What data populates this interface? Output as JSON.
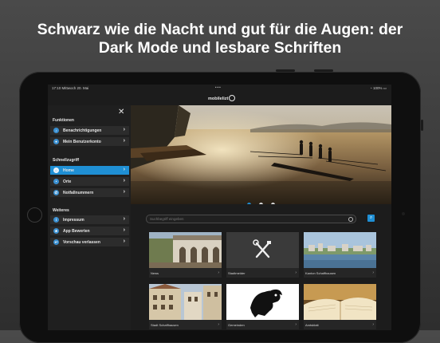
{
  "headline": {
    "line1": "Schwarz wie die Nacht und gut für die Augen: der",
    "line2": "Dark Mode und lesbare Schriften"
  },
  "statusbar": {
    "time_date": "17:10  Mittwoch 20. Mai",
    "center": "•••",
    "battery": "100%"
  },
  "navbar": {
    "logo_text": "mobilelizt"
  },
  "sidebar": {
    "section1_title": "Funktionen",
    "section1_items": [
      {
        "label": "Benachrichtigungen",
        "icon": "bell-icon"
      },
      {
        "label": "Mein Benutzerkonto",
        "icon": "user-icon"
      }
    ],
    "section2_title": "Schnellzugriff",
    "section2_items": [
      {
        "label": "Home",
        "icon": "home-icon",
        "active": true
      },
      {
        "label": "Orte",
        "icon": "pin-icon"
      },
      {
        "label": "Notfallnummern",
        "icon": "phone-icon"
      }
    ],
    "section3_title": "Weiteres",
    "section3_items": [
      {
        "label": "Impressum",
        "icon": "info-icon"
      },
      {
        "label": "App Bewerten",
        "icon": "star-icon"
      },
      {
        "label": "Vorschau verlassen",
        "icon": "exit-icon"
      }
    ]
  },
  "slider": {
    "total": 3,
    "active_index": 0
  },
  "search": {
    "placeholder": "Suchbegriff eingeben"
  },
  "tiles": [
    {
      "label": "News"
    },
    {
      "label": "Stadtmelder"
    },
    {
      "label": "Kanton Schaffhausen"
    },
    {
      "label": "Stadt Schaffhausen"
    },
    {
      "label": "Gemeinden"
    },
    {
      "label": "Amtsblatt"
    }
  ],
  "colors": {
    "accent": "#1f8fd4",
    "background": "#1c1c1c"
  }
}
